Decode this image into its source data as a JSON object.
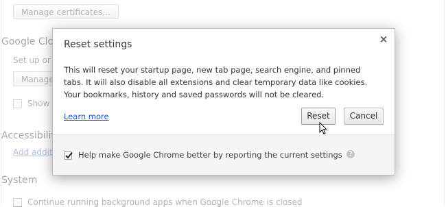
{
  "background": {
    "manage_certificates_button": "Manage certificates...",
    "google_cloud_heading": "Google Clou",
    "setup_text": "Set up or m",
    "manage_button": "Manage",
    "show_text": "Show n",
    "accessibility_heading": "Accessibility",
    "add_additional_link": "Add additio",
    "system_heading": "System",
    "continue_running_text": "Continue running background apps when Google Chrome is closed"
  },
  "dialog": {
    "title": "Reset settings",
    "close_glyph": "×",
    "body": "This will reset your startup page, new tab page, search engine, and pinned tabs. It will also disable all extensions and clear temporary data like cookies. Your bookmarks, history and saved passwords will not be cleared.",
    "learn_more": "Learn more",
    "reset_button": "Reset",
    "cancel_button": "Cancel",
    "checkbox_label": "Help make Google Chrome better by reporting the current settings",
    "checkbox_checked": true,
    "help_glyph": "?"
  },
  "colors": {
    "link": "#1a56c4",
    "background_link": "#6f8fbf"
  }
}
